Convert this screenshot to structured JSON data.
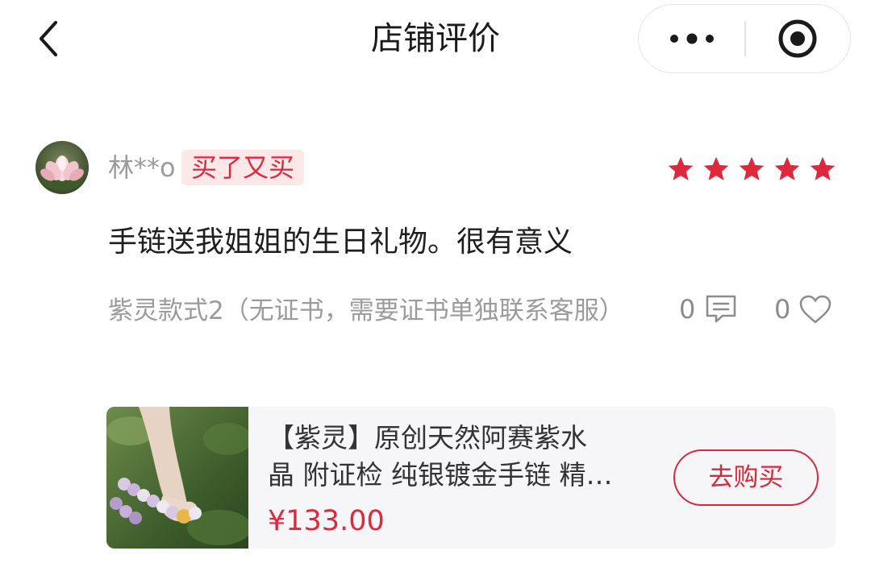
{
  "header": {
    "title": "店铺评价",
    "back_icon": "chevron-left-icon",
    "more_icon": "more-dots-icon",
    "close_icon": "target-circle-icon"
  },
  "review": {
    "user_name": "林**o",
    "badge": "买了又买",
    "rating": 5,
    "rating_max": 5,
    "content": "手链送我姐姐的生日礼物。很有意义",
    "variant": "紫灵款式2（无证书，需要证书单独联系客服）",
    "reply_count": "0",
    "like_count": "0"
  },
  "product": {
    "title_line1": "【紫灵】原创天然阿赛紫水",
    "title_line2": "晶 附证检 纯银镀金手链 精…",
    "price": "¥133.00",
    "buy_label": "去购买"
  },
  "colors": {
    "accent_red": "#e0283c",
    "badge_bg": "#fde8e9",
    "muted_text": "#9b9b9b",
    "card_bg": "#f6f6f8"
  }
}
